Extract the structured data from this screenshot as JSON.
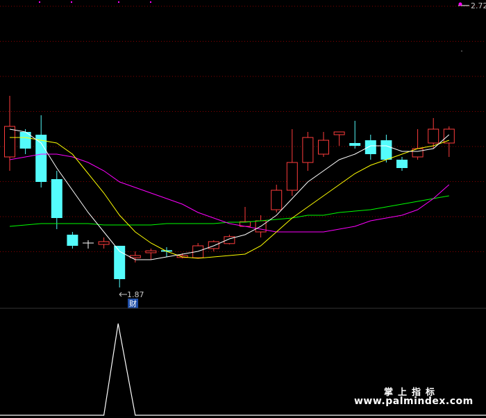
{
  "chart_data": {
    "type": "candlestick",
    "price_labels": {
      "high": "2.72",
      "low": "1.87"
    },
    "marker_text": "财",
    "colors": {
      "background": "#000000",
      "up": "#ff3c3c",
      "down": "#54fcfc",
      "ma_short": "#ffffff",
      "ma_mid": "#ffff00",
      "ma_long": "#ff00ff",
      "ma_longest": "#00ff00",
      "grid": "#8b0000",
      "indicator": "#ffffff"
    },
    "candles": [
      {
        "o": 2.34,
        "h": 2.56,
        "l": 2.29,
        "c": 2.45
      },
      {
        "o": 2.43,
        "h": 2.44,
        "l": 2.35,
        "c": 2.37
      },
      {
        "o": 2.42,
        "h": 2.49,
        "l": 2.23,
        "c": 2.25
      },
      {
        "o": 2.26,
        "h": 2.29,
        "l": 2.08,
        "c": 2.12
      },
      {
        "o": 2.06,
        "h": 2.07,
        "l": 2.01,
        "c": 2.02
      },
      {
        "o": 2.03,
        "h": 2.04,
        "l": 2.01,
        "c": 2.03
      },
      {
        "o": 2.025,
        "h": 2.05,
        "l": 2.01,
        "c": 2.035
      },
      {
        "o": 2.02,
        "h": 2.02,
        "l": 1.87,
        "c": 1.9
      },
      {
        "o": 1.977,
        "h": 2.0,
        "l": 1.96,
        "c": 1.985
      },
      {
        "o": 1.995,
        "h": 2.01,
        "l": 1.97,
        "c": 2.002
      },
      {
        "o": 2.004,
        "h": 2.015,
        "l": 1.98,
        "c": 1.999
      },
      {
        "o": 1.978,
        "h": 1.993,
        "l": 1.975,
        "c": 1.985
      },
      {
        "o": 1.977,
        "h": 2.03,
        "l": 1.975,
        "c": 2.02
      },
      {
        "o": 2.01,
        "h": 2.04,
        "l": 2.0,
        "c": 2.035
      },
      {
        "o": 2.028,
        "h": 2.06,
        "l": 2.025,
        "c": 2.053
      },
      {
        "o": 2.09,
        "h": 2.16,
        "l": 2.09,
        "c": 2.107
      },
      {
        "o": 2.07,
        "h": 2.13,
        "l": 2.05,
        "c": 2.11
      },
      {
        "o": 2.15,
        "h": 2.24,
        "l": 2.14,
        "c": 2.22
      },
      {
        "o": 2.22,
        "h": 2.44,
        "l": 2.2,
        "c": 2.32
      },
      {
        "o": 2.32,
        "h": 2.43,
        "l": 2.29,
        "c": 2.41
      },
      {
        "o": 2.35,
        "h": 2.43,
        "l": 2.34,
        "c": 2.4
      },
      {
        "o": 2.42,
        "h": 2.43,
        "l": 2.38,
        "c": 2.43
      },
      {
        "o": 2.39,
        "h": 2.47,
        "l": 2.37,
        "c": 2.38
      },
      {
        "o": 2.4,
        "h": 2.42,
        "l": 2.33,
        "c": 2.35
      },
      {
        "o": 2.4,
        "h": 2.42,
        "l": 2.32,
        "c": 2.33
      },
      {
        "o": 2.33,
        "h": 2.34,
        "l": 2.29,
        "c": 2.3
      },
      {
        "o": 2.34,
        "h": 2.44,
        "l": 2.33,
        "c": 2.37
      },
      {
        "o": 2.39,
        "h": 2.48,
        "l": 2.37,
        "c": 2.44
      },
      {
        "o": 2.39,
        "h": 2.45,
        "l": 2.34,
        "c": 2.44
      }
    ],
    "ma_short": [
      2.44,
      2.43,
      2.39,
      2.3,
      2.22,
      2.14,
      2.07,
      2.0,
      1.97,
      1.97,
      1.98,
      1.99,
      2.0,
      2.02,
      2.045,
      2.06,
      2.09,
      2.13,
      2.19,
      2.25,
      2.29,
      2.33,
      2.35,
      2.38,
      2.38,
      2.36,
      2.36,
      2.37,
      2.42
    ],
    "ma_mid": [
      2.41,
      2.41,
      2.4,
      2.39,
      2.35,
      2.28,
      2.21,
      2.13,
      2.07,
      2.03,
      2.0,
      1.98,
      1.975,
      1.98,
      1.985,
      1.99,
      2.02,
      2.07,
      2.12,
      2.16,
      2.2,
      2.24,
      2.28,
      2.31,
      2.33,
      2.35,
      2.37,
      2.38,
      2.4
    ],
    "ma_long": [
      2.33,
      2.34,
      2.35,
      2.35,
      2.34,
      2.32,
      2.29,
      2.25,
      2.23,
      2.21,
      2.19,
      2.17,
      2.14,
      2.12,
      2.1,
      2.09,
      2.08,
      2.07,
      2.07,
      2.07,
      2.07,
      2.08,
      2.09,
      2.11,
      2.12,
      2.13,
      2.15,
      2.19,
      2.24
    ],
    "ma_longest": [
      2.09,
      2.095,
      2.1,
      2.1,
      2.1,
      2.1,
      2.095,
      2.095,
      2.095,
      2.095,
      2.1,
      2.1,
      2.1,
      2.1,
      2.105,
      2.105,
      2.11,
      2.115,
      2.12,
      2.13,
      2.13,
      2.14,
      2.145,
      2.15,
      2.16,
      2.17,
      2.18,
      2.19,
      2.2
    ],
    "indicator": [
      0,
      0,
      0,
      0,
      0,
      0,
      0,
      1,
      0,
      0,
      0,
      0,
      0,
      0,
      0,
      0,
      0,
      0,
      0,
      0,
      0,
      0,
      0,
      0,
      0,
      0,
      0,
      0,
      0
    ]
  },
  "watermark": {
    "line1": "掌上指标",
    "line2": "www.palmindex.com"
  }
}
